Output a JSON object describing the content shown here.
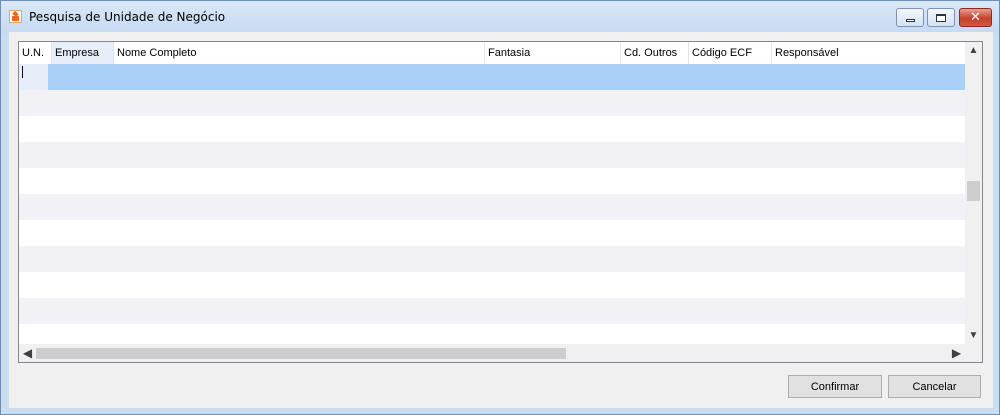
{
  "window": {
    "title": "Pesquisa de Unidade de Negócio",
    "controls": {
      "minimize": "▁",
      "maximize": "□",
      "close": "✕"
    }
  },
  "grid": {
    "columns": [
      {
        "label": "U.N."
      },
      {
        "label": "Empresa"
      },
      {
        "label": "Nome Completo"
      },
      {
        "label": "Fantasia"
      },
      {
        "label": "Cd. Outros"
      },
      {
        "label": "Código ECF"
      },
      {
        "label": "Responsável"
      }
    ],
    "selected_column": "Empresa",
    "rows": [],
    "scroll": {
      "up": "▲",
      "down": "▼",
      "left": "◀",
      "right": "▶"
    }
  },
  "buttons": {
    "confirm": "Confirmar",
    "cancel": "Cancelar"
  },
  "colors": {
    "selected_row": "#a9d1f7",
    "alt_row": "#f2f2f6",
    "title_bar": "#c5daf1",
    "close_button": "#c4402b"
  }
}
